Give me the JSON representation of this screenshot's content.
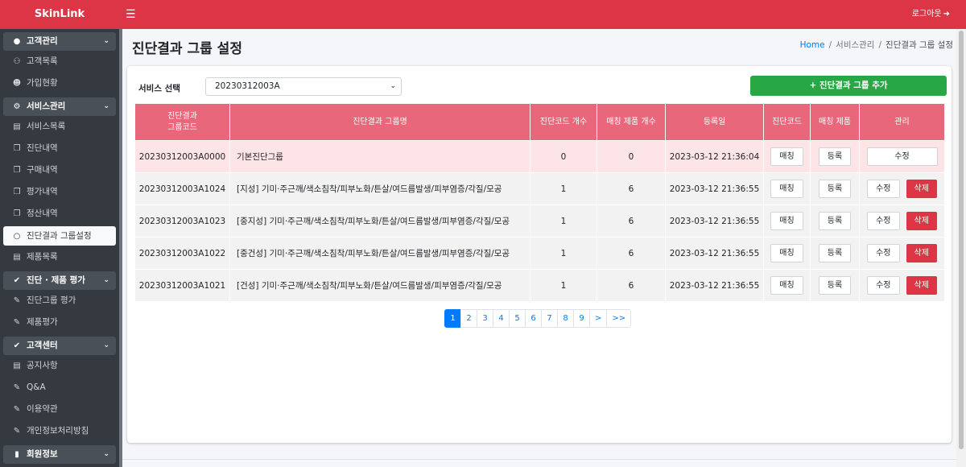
{
  "app": {
    "brand": "SkinLink",
    "logout": "로그아웃"
  },
  "sidebar": {
    "groups": [
      {
        "label": "고객관리",
        "items": [
          "고객목록",
          "가입현황"
        ]
      },
      {
        "label": "서비스관리",
        "items": [
          "서비스목록",
          "진단내역",
          "구매내역",
          "평가내역",
          "정산내역",
          "진단결과 그룹설정",
          "제품목록"
        ]
      },
      {
        "label": "진단 · 제품 평가",
        "items": [
          "진단그룹 평가",
          "제품평가"
        ]
      },
      {
        "label": "고객센터",
        "items": [
          "공지사항",
          "Q&A",
          "이용약관",
          "개인정보처리방침"
        ]
      },
      {
        "label": "회원정보",
        "items": []
      }
    ]
  },
  "page": {
    "title": "진단결과 그룹 설정",
    "breadcrumb": {
      "home": "Home",
      "section": "서비스관리",
      "current": "진단결과 그룹 설정"
    }
  },
  "filter": {
    "label": "서비스 선택",
    "selected": "20230312003A"
  },
  "add_button": "+ 진단결과 그룹 추가",
  "table": {
    "headers": {
      "code_line1": "진단결과",
      "code_line2": "그룹코드",
      "name": "진단결과 그룹명",
      "diag_count": "진단코드 개수",
      "match_count": "매칭 제품 개수",
      "date": "등록일",
      "diag_code": "진단코드",
      "match_product": "매칭 제품",
      "manage": "관리"
    },
    "rows": [
      {
        "code": "20230312003A0000",
        "name": "기본진단그룹",
        "diag": "0",
        "match": "0",
        "date": "2023-03-12 21:36:04"
      },
      {
        "code": "20230312003A1024",
        "name": "[지성] 기미·주근깨/색소침착/피부노화/튼살/여드름발생/피부염증/각질/모공",
        "diag": "1",
        "match": "6",
        "date": "2023-03-12 21:36:55"
      },
      {
        "code": "20230312003A1023",
        "name": "[중지성] 기미·주근깨/색소침착/피부노화/튼살/여드름발생/피부염증/각질/모공",
        "diag": "1",
        "match": "6",
        "date": "2023-03-12 21:36:55"
      },
      {
        "code": "20230312003A1022",
        "name": "[중건성] 기미·주근깨/색소침착/피부노화/튼살/여드름발생/피부염증/각질/모공",
        "diag": "1",
        "match": "6",
        "date": "2023-03-12 21:36:55"
      },
      {
        "code": "20230312003A1021",
        "name": "[건성] 기미·주근깨/색소침착/피부노화/튼살/여드름발생/피부염증/각질/모공",
        "diag": "1",
        "match": "6",
        "date": "2023-03-12 21:36:55"
      }
    ],
    "buttons": {
      "match": "매칭",
      "register": "등록",
      "edit": "수정",
      "delete": "삭제"
    }
  },
  "pagination": {
    "pages": [
      "1",
      "2",
      "3",
      "4",
      "5",
      "6",
      "7",
      "8",
      "9"
    ],
    "next": ">",
    "last": ">>",
    "active": "1"
  }
}
